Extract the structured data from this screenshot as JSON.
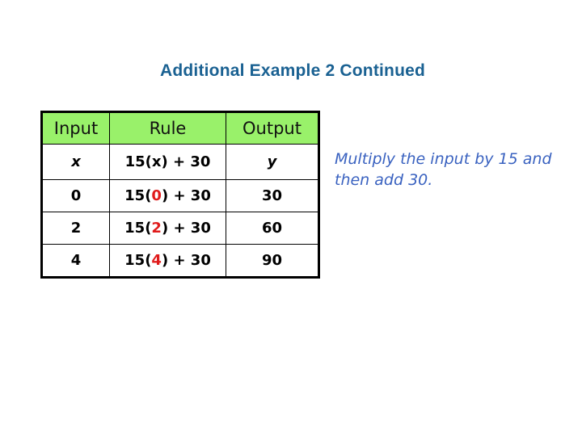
{
  "slide": {
    "title": "Additional Example 2 Continued",
    "note": "Multiply the input by 15 and then add 30."
  },
  "table": {
    "headers": [
      "Input",
      "Rule",
      "Output"
    ],
    "variable_row": {
      "input": "x",
      "rule": "15(x) + 30",
      "output": "y"
    },
    "rows": [
      {
        "input": "0",
        "rule_prefix": "15(",
        "rule_value": "0",
        "rule_suffix": ") + 30",
        "output": "30"
      },
      {
        "input": "2",
        "rule_prefix": "15(",
        "rule_value": "2",
        "rule_suffix": ") + 30",
        "output": "60"
      },
      {
        "input": "4",
        "rule_prefix": "15(",
        "rule_value": "4",
        "rule_suffix": ") + 30",
        "output": "90"
      }
    ]
  },
  "colors": {
    "title": "#1a6192",
    "header_bg": "#99f16a",
    "highlight": "#e01b1b",
    "note": "#3a62c0"
  }
}
